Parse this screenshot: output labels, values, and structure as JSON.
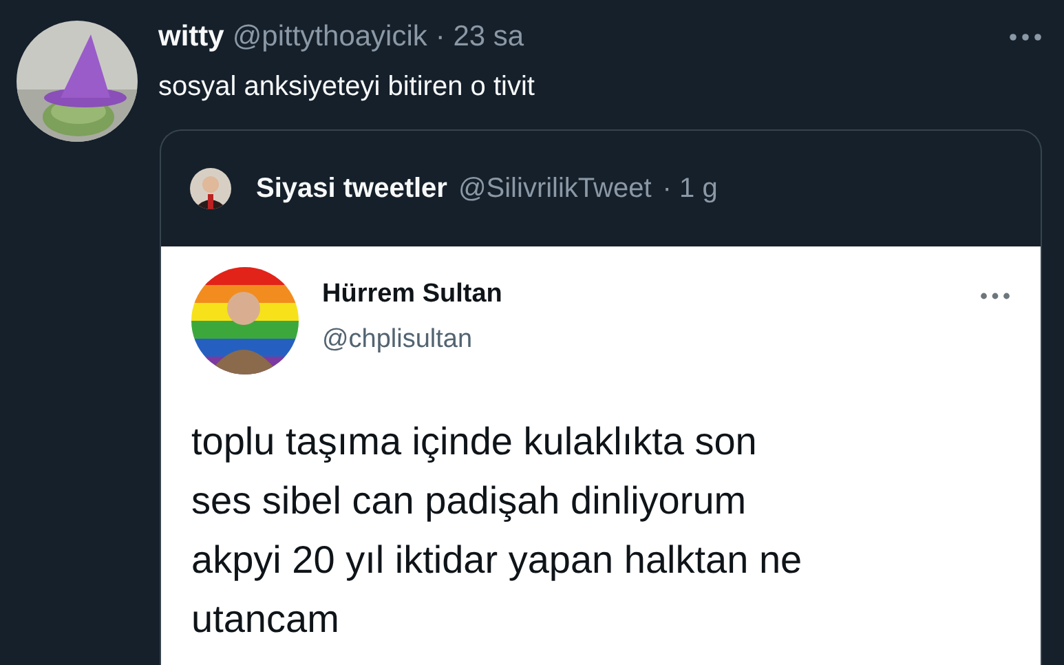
{
  "tweet": {
    "author": {
      "name": "witty",
      "handle": "@pittythoayicik",
      "time": "· 23 sa"
    },
    "text": "sosyal anksiyeteyi bitiren o tivit",
    "quote": {
      "author": {
        "name": "Siyasi tweetler",
        "handle": "@SilivrilikTweet",
        "time": "· 1 g"
      },
      "screenshot": {
        "author": {
          "name": "Hürrem Sultan",
          "handle": "@chplisultan"
        },
        "text": "toplu taşıma içinde kulaklıkta son\nses sibel can padişah dinliyorum\nakpyi 20 yıl iktidar yapan halktan ne\nutancam"
      }
    }
  }
}
